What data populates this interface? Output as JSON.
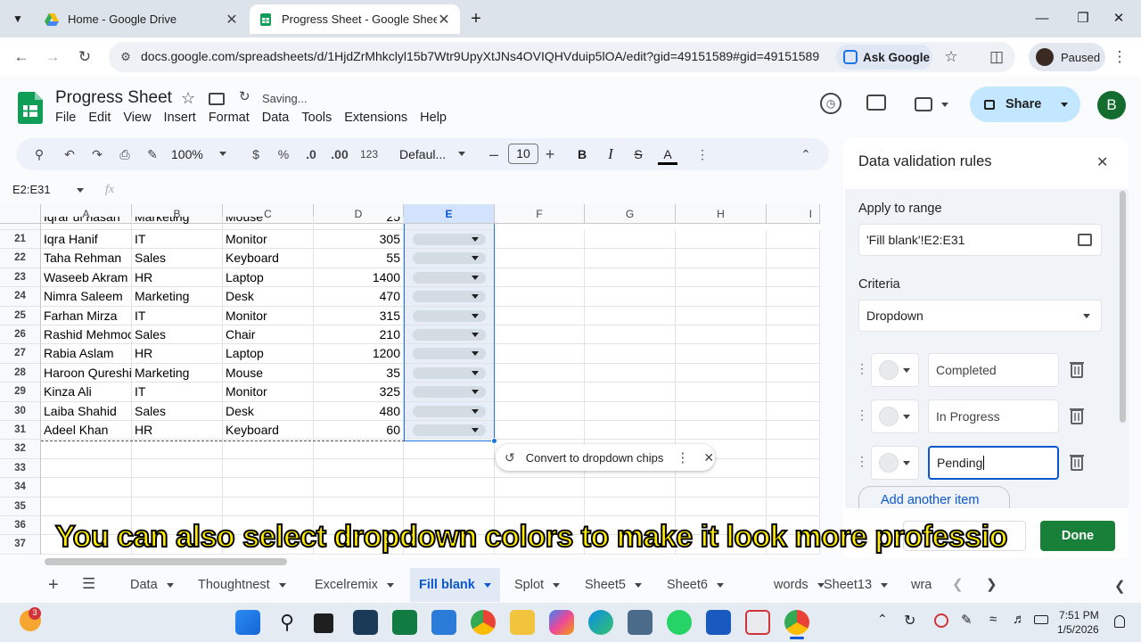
{
  "browser": {
    "tabs": [
      {
        "title": "Home - Google Drive"
      },
      {
        "title": "Progress Sheet - Google Sheets"
      }
    ],
    "url": "docs.google.com/spreadsheets/d/1HjdZrMhkclyl15b7Wtr9UpyXtJNs4OVIQHVduip5lOA/edit?gid=49151589#gid=49151589",
    "ask_google": "Ask Google",
    "profile_status": "Paused"
  },
  "sheets": {
    "doc_title": "Progress Sheet",
    "status": "Saving...",
    "menu": [
      "File",
      "Edit",
      "View",
      "Insert",
      "Format",
      "Data",
      "Tools",
      "Extensions",
      "Help"
    ],
    "share_label": "Share",
    "user_initial": "B",
    "toolbar": {
      "zoom": "100%",
      "currency": "$",
      "percent": "%",
      "dec_decrease": ".0",
      "dec_increase": ".00",
      "format_123": "123",
      "font": "Defaul...",
      "font_size": "10"
    },
    "name_box": "E2:E31",
    "fx": "fx",
    "columns": [
      "A",
      "B",
      "C",
      "D",
      "E",
      "F",
      "G",
      "H",
      "I"
    ],
    "partial_row": {
      "name": "Iqrar ul hasan",
      "dept": "Marketing",
      "item": "Mouse",
      "qty": "25"
    },
    "rows": [
      {
        "num": "21",
        "name": "Iqra Hanif",
        "dept": "IT",
        "item": "Monitor",
        "qty": "305"
      },
      {
        "num": "22",
        "name": "Taha Rehman",
        "dept": "Sales",
        "item": "Keyboard",
        "qty": "55"
      },
      {
        "num": "23",
        "name": "Waseeb Akram",
        "dept": "HR",
        "item": "Laptop",
        "qty": "1400"
      },
      {
        "num": "24",
        "name": "Nimra Saleem",
        "dept": "Marketing",
        "item": "Desk",
        "qty": "470"
      },
      {
        "num": "25",
        "name": "Farhan Mirza",
        "dept": "IT",
        "item": "Monitor",
        "qty": "315"
      },
      {
        "num": "26",
        "name": "Rashid Mehmood",
        "dept": "Sales",
        "item": "Chair",
        "qty": "210"
      },
      {
        "num": "27",
        "name": "Rabia Aslam",
        "dept": "HR",
        "item": "Laptop",
        "qty": "1200"
      },
      {
        "num": "28",
        "name": "Haroon Qureshi",
        "dept": "Marketing",
        "item": "Mouse",
        "qty": "35"
      },
      {
        "num": "29",
        "name": "Kinza Ali",
        "dept": "IT",
        "item": "Monitor",
        "qty": "325"
      },
      {
        "num": "30",
        "name": "Laiba Shahid",
        "dept": "Sales",
        "item": "Desk",
        "qty": "480"
      },
      {
        "num": "31",
        "name": "Adeel Khan",
        "dept": "HR",
        "item": "Keyboard",
        "qty": "60"
      }
    ],
    "empty_rows": [
      "32",
      "33",
      "34",
      "35",
      "36",
      "37"
    ],
    "convert_popup": "Convert to dropdown chips",
    "sheet_tabs": [
      "Data",
      "Thoughtnest",
      "Excelremix",
      "Fill blank",
      "Splot",
      "Sheet5",
      "Sheet6",
      "words",
      "Sheet13",
      "wra"
    ],
    "active_sheet": "Fill blank"
  },
  "validation_panel": {
    "title": "Data validation rules",
    "apply_label": "Apply to range",
    "range": "'Fill blank'!E2:E31",
    "criteria_label": "Criteria",
    "criteria_value": "Dropdown",
    "items": [
      "Completed",
      "In Progress",
      "Pending"
    ],
    "add_item": "Add another item",
    "done": "Done"
  },
  "caption": "You can also select dropdown colors to make it look more professio",
  "taskbar": {
    "time": "7:51 PM",
    "date": "1/5/2026",
    "badge": "3"
  }
}
